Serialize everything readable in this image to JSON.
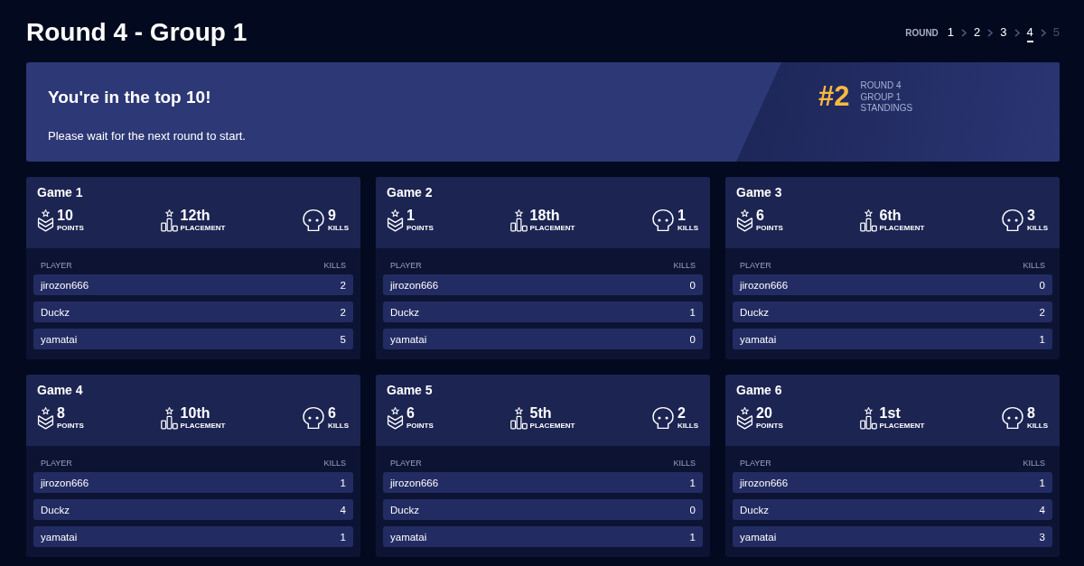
{
  "title": "Round 4 - Group 1",
  "round_nav": {
    "label": "ROUND",
    "rounds": [
      {
        "label": "1",
        "selected": false,
        "disabled": false
      },
      {
        "label": "2",
        "selected": false,
        "disabled": false
      },
      {
        "label": "3",
        "selected": false,
        "disabled": false
      },
      {
        "label": "4",
        "selected": true,
        "disabled": false
      },
      {
        "label": "5",
        "selected": false,
        "disabled": true
      }
    ]
  },
  "banner": {
    "heading": "You're in the top 10!",
    "message": "Please wait for the next round to start.",
    "rank": "#2",
    "rank_lines": [
      "ROUND 4",
      "GROUP 1",
      "STANDINGS"
    ]
  },
  "games": [
    {
      "title": "Game 1",
      "stats": [
        {
          "kind": "points",
          "value": "10",
          "label": "POINTS"
        },
        {
          "kind": "placement",
          "value": "12th",
          "label": "PLACEMENT"
        },
        {
          "kind": "kills",
          "value": "9",
          "label": "KILLS"
        }
      ],
      "columns": [
        "PLAYER",
        "KILLS"
      ],
      "players": [
        {
          "name": "jirozon666",
          "kills": "2"
        },
        {
          "name": "Duckz",
          "kills": "2"
        },
        {
          "name": "yamatai",
          "kills": "5"
        }
      ]
    },
    {
      "title": "Game 2",
      "stats": [
        {
          "kind": "points",
          "value": "1",
          "label": "POINTS"
        },
        {
          "kind": "placement",
          "value": "18th",
          "label": "PLACEMENT"
        },
        {
          "kind": "kills",
          "value": "1",
          "label": "KILLS"
        }
      ],
      "columns": [
        "PLAYER",
        "KILLS"
      ],
      "players": [
        {
          "name": "jirozon666",
          "kills": "0"
        },
        {
          "name": "Duckz",
          "kills": "1"
        },
        {
          "name": "yamatai",
          "kills": "0"
        }
      ]
    },
    {
      "title": "Game 3",
      "stats": [
        {
          "kind": "points",
          "value": "6",
          "label": "POINTS"
        },
        {
          "kind": "placement",
          "value": "6th",
          "label": "PLACEMENT"
        },
        {
          "kind": "kills",
          "value": "3",
          "label": "KILLS"
        }
      ],
      "columns": [
        "PLAYER",
        "KILLS"
      ],
      "players": [
        {
          "name": "jirozon666",
          "kills": "0"
        },
        {
          "name": "Duckz",
          "kills": "2"
        },
        {
          "name": "yamatai",
          "kills": "1"
        }
      ]
    },
    {
      "title": "Game 4",
      "stats": [
        {
          "kind": "points",
          "value": "8",
          "label": "POINTS"
        },
        {
          "kind": "placement",
          "value": "10th",
          "label": "PLACEMENT"
        },
        {
          "kind": "kills",
          "value": "6",
          "label": "KILLS"
        }
      ],
      "columns": [
        "PLAYER",
        "KILLS"
      ],
      "players": [
        {
          "name": "jirozon666",
          "kills": "1"
        },
        {
          "name": "Duckz",
          "kills": "4"
        },
        {
          "name": "yamatai",
          "kills": "1"
        }
      ]
    },
    {
      "title": "Game 5",
      "stats": [
        {
          "kind": "points",
          "value": "6",
          "label": "POINTS"
        },
        {
          "kind": "placement",
          "value": "5th",
          "label": "PLACEMENT"
        },
        {
          "kind": "kills",
          "value": "2",
          "label": "KILLS"
        }
      ],
      "columns": [
        "PLAYER",
        "KILLS"
      ],
      "players": [
        {
          "name": "jirozon666",
          "kills": "1"
        },
        {
          "name": "Duckz",
          "kills": "0"
        },
        {
          "name": "yamatai",
          "kills": "1"
        }
      ]
    },
    {
      "title": "Game 6",
      "stats": [
        {
          "kind": "points",
          "value": "20",
          "label": "POINTS"
        },
        {
          "kind": "placement",
          "value": "1st",
          "label": "PLACEMENT"
        },
        {
          "kind": "kills",
          "value": "8",
          "label": "KILLS"
        }
      ],
      "columns": [
        "PLAYER",
        "KILLS"
      ],
      "players": [
        {
          "name": "jirozon666",
          "kills": "1"
        },
        {
          "name": "Duckz",
          "kills": "4"
        },
        {
          "name": "yamatai",
          "kills": "3"
        }
      ]
    }
  ]
}
